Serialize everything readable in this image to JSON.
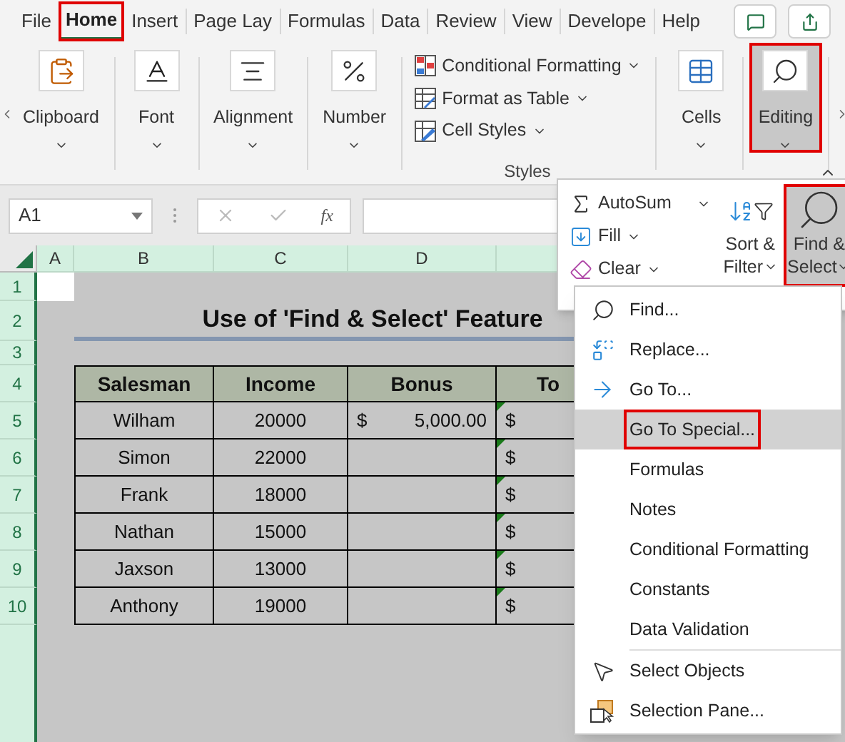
{
  "tabs": [
    {
      "label": "File",
      "selected": false,
      "highlighted": false
    },
    {
      "label": "Home",
      "selected": true,
      "highlighted": true
    },
    {
      "label": "Insert",
      "selected": false,
      "highlighted": false
    },
    {
      "label": "Page Lay",
      "selected": false,
      "highlighted": false
    },
    {
      "label": "Formulas",
      "selected": false,
      "highlighted": false
    },
    {
      "label": "Data",
      "selected": false,
      "highlighted": false
    },
    {
      "label": "Review",
      "selected": false,
      "highlighted": false
    },
    {
      "label": "View",
      "selected": false,
      "highlighted": false
    },
    {
      "label": "Develope",
      "selected": false,
      "highlighted": false
    },
    {
      "label": "Help",
      "selected": false,
      "highlighted": false
    }
  ],
  "ribbon": {
    "groups": [
      {
        "kind": "button",
        "label": "Clipboard",
        "selected": false,
        "highlighted": false
      },
      {
        "kind": "button",
        "label": "Font",
        "selected": false,
        "highlighted": false
      },
      {
        "kind": "button",
        "label": "Alignment",
        "selected": false,
        "highlighted": false
      },
      {
        "kind": "button",
        "label": "Number",
        "selected": false,
        "highlighted": false
      },
      {
        "kind": "styles",
        "label": "Styles",
        "selected": false,
        "highlighted": false,
        "items": [
          {
            "label": "Conditional Formatting"
          },
          {
            "label": "Format as Table"
          },
          {
            "label": "Cell Styles"
          }
        ]
      },
      {
        "kind": "button",
        "label": "Cells",
        "selected": false,
        "highlighted": false
      },
      {
        "kind": "button",
        "label": "Editing",
        "selected": true,
        "highlighted": true
      }
    ]
  },
  "formula_bar": {
    "name_box": "A1",
    "function_label": "fx"
  },
  "sheet": {
    "columns": [
      "A",
      "B",
      "C",
      "D"
    ],
    "row_numbers": [
      "1",
      "2",
      "3",
      "4",
      "5",
      "6",
      "7",
      "8",
      "9",
      "10"
    ],
    "title": "Use of 'Find & Select' Feature",
    "headers": [
      "Salesman",
      "Income",
      "Bonus",
      "To"
    ],
    "rows": [
      {
        "salesman": "Wilham",
        "income": "20000",
        "bonus_currency": "$",
        "bonus_amount": "5,000.00",
        "total_currency": "$",
        "error_flag": true
      },
      {
        "salesman": "Simon",
        "income": "22000",
        "total_currency": "$",
        "error_flag": true
      },
      {
        "salesman": "Frank",
        "income": "18000",
        "total_currency": "$",
        "error_flag": true
      },
      {
        "salesman": "Nathan",
        "income": "15000",
        "total_currency": "$",
        "error_flag": true
      },
      {
        "salesman": "Jaxson",
        "income": "13000",
        "total_currency": "$",
        "error_flag": true
      },
      {
        "salesman": "Anthony",
        "income": "19000",
        "total_currency": "$",
        "error_flag": true
      }
    ]
  },
  "editing_panel": {
    "items": [
      {
        "label": "AutoSum"
      },
      {
        "label": "Fill"
      },
      {
        "label": "Clear"
      }
    ],
    "sort_filter": {
      "label_lines": [
        "Sort &",
        "Filter"
      ],
      "selected": false,
      "highlighted": false
    },
    "find_select": {
      "label_lines": [
        "Find &",
        "Select"
      ],
      "selected": true,
      "highlighted": true
    }
  },
  "find_menu": {
    "sections": [
      [
        {
          "label": "Find...",
          "selected": false,
          "highlighted": false
        },
        {
          "label": "Replace...",
          "selected": false,
          "highlighted": false
        },
        {
          "label": "Go To...",
          "selected": false,
          "highlighted": false
        },
        {
          "label": "Go To Special...",
          "selected": true,
          "highlighted": true
        },
        {
          "label": "Formulas",
          "selected": false,
          "highlighted": false
        },
        {
          "label": "Notes",
          "selected": false,
          "highlighted": false
        },
        {
          "label": "Conditional Formatting",
          "selected": false,
          "highlighted": false
        },
        {
          "label": "Constants",
          "selected": false,
          "highlighted": false
        },
        {
          "label": "Data Validation",
          "selected": false,
          "highlighted": false
        }
      ],
      [
        {
          "label": "Select Objects",
          "selected": false,
          "highlighted": false
        },
        {
          "label": "Selection Pane...",
          "selected": false,
          "highlighted": false
        }
      ]
    ]
  }
}
